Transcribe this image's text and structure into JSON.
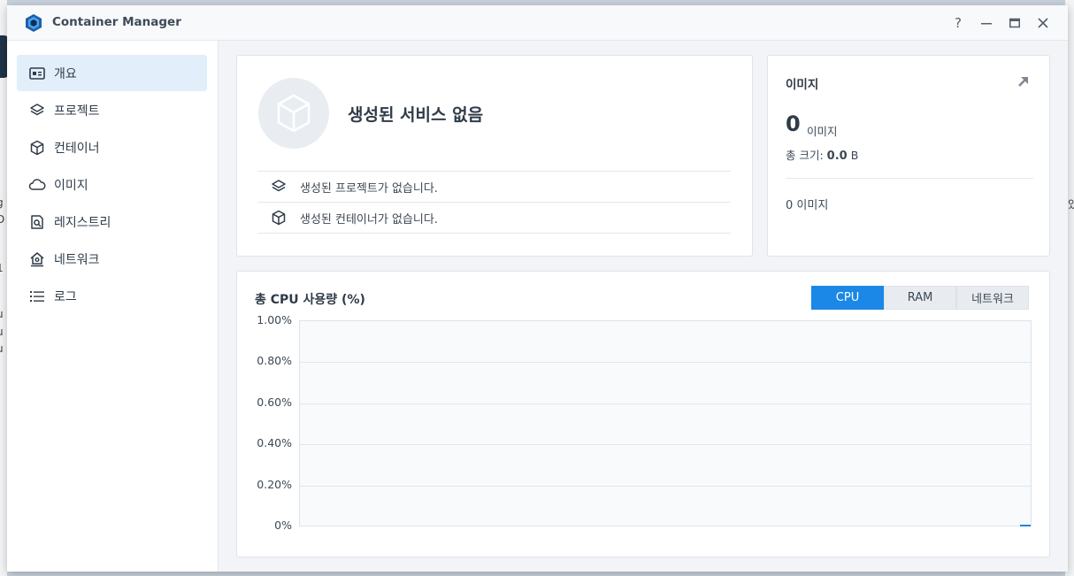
{
  "window": {
    "title": "Container Manager"
  },
  "titlebar_buttons": {
    "help": "?",
    "minimize": "–",
    "maximize": "□",
    "close": "✕"
  },
  "background_fragments": {
    "left": [
      "g",
      "D",
      "1",
      "u",
      "u",
      "u"
    ],
    "right": "있"
  },
  "sidebar": {
    "items": [
      {
        "label": "개요",
        "icon": "overview-icon",
        "active": true
      },
      {
        "label": "프로젝트",
        "icon": "layers-icon",
        "active": false
      },
      {
        "label": "컨테이너",
        "icon": "box-icon",
        "active": false
      },
      {
        "label": "이미지",
        "icon": "cloud-icon",
        "active": false
      },
      {
        "label": "레지스트리",
        "icon": "registry-search-icon",
        "active": false
      },
      {
        "label": "네트워크",
        "icon": "network-home-icon",
        "active": false
      },
      {
        "label": "로그",
        "icon": "list-icon",
        "active": false
      }
    ]
  },
  "services": {
    "title": "생성된 서비스 없음",
    "rows": [
      {
        "icon": "layers-icon",
        "text": "생성된 프로젝트가 없습니다."
      },
      {
        "icon": "box-icon",
        "text": "생성된 컨테이너가 없습니다."
      }
    ]
  },
  "images": {
    "title": "이미지",
    "count": "0",
    "count_unit": "이미지",
    "size_label": "총 크기:",
    "size_value": "0.0",
    "size_unit": "B",
    "list_summary": "0 이미지"
  },
  "chart_data": {
    "type": "line",
    "title": "총 CPU 사용량 (%)",
    "tabs": [
      {
        "label": "CPU",
        "active": true
      },
      {
        "label": "RAM",
        "active": false
      },
      {
        "label": "네트워크",
        "active": false
      }
    ],
    "yticks": [
      "1.00%",
      "0.80%",
      "0.60%",
      "0.40%",
      "0.20%",
      "0%"
    ],
    "ylim": [
      0,
      1.0
    ],
    "series": [
      {
        "color": "#1b87e6",
        "values": [
          0
        ]
      }
    ],
    "grid": true
  },
  "colors": {
    "accent": "#1b87e6",
    "active_nav_bg": "#e3eefb"
  }
}
